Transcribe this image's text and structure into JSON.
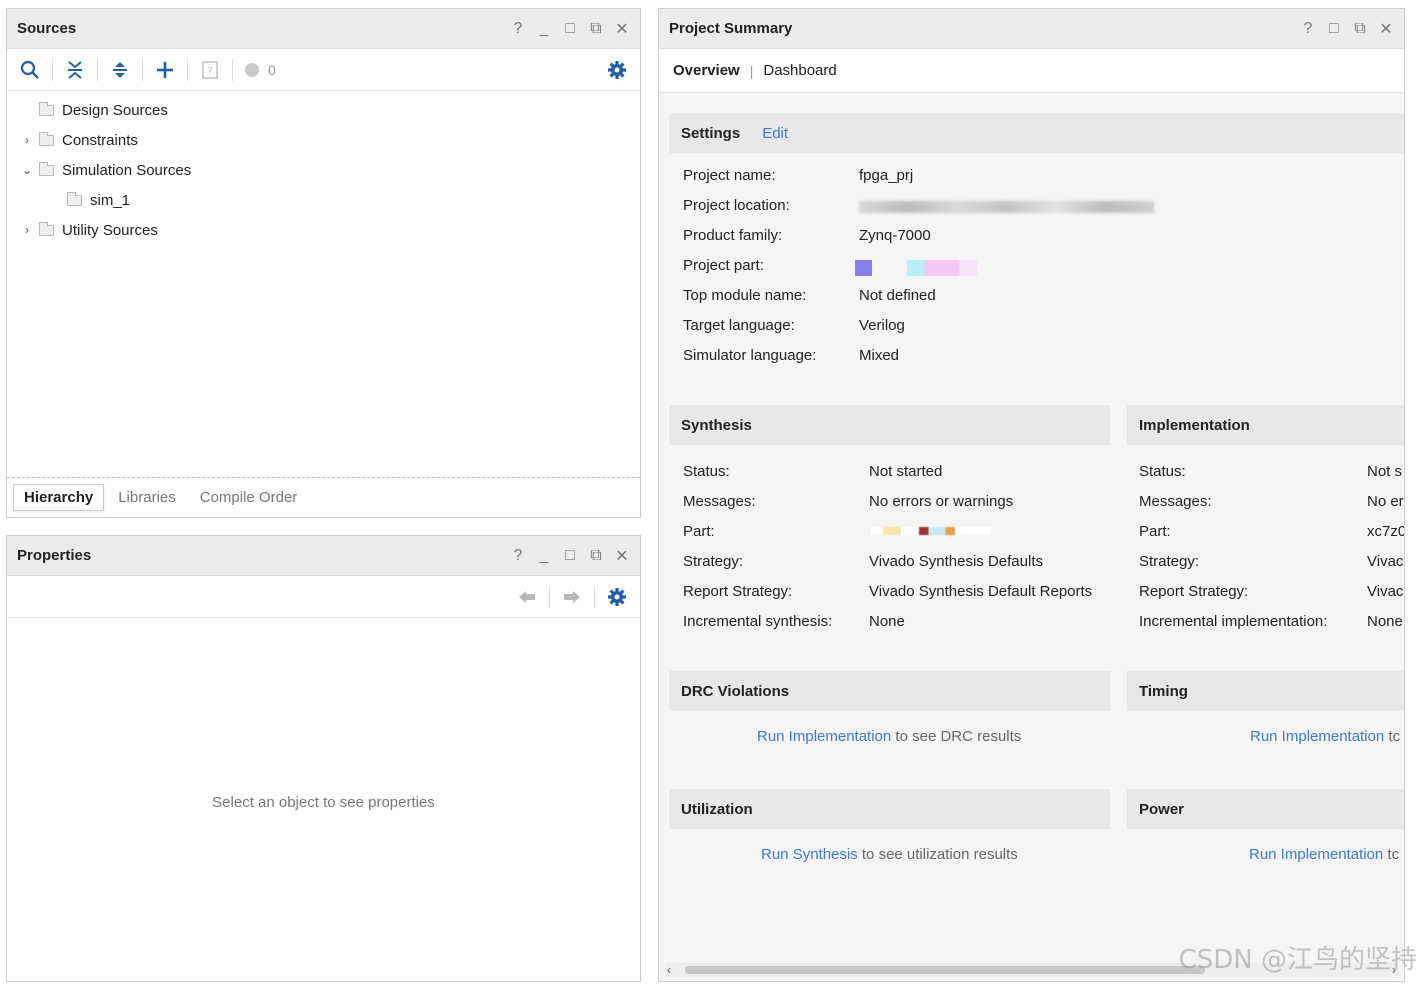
{
  "sources": {
    "title": "Sources",
    "controls": [
      "?",
      "_",
      "□",
      "⧉",
      "✕"
    ],
    "error_count": "0",
    "tree": [
      {
        "label": "Design Sources",
        "arrow": ""
      },
      {
        "label": "Constraints",
        "arrow": "›"
      },
      {
        "label": "Simulation Sources",
        "arrow": "⌄"
      },
      {
        "label": "sim_1",
        "arrow": ""
      },
      {
        "label": "Utility Sources",
        "arrow": "›"
      }
    ],
    "tabs": [
      "Hierarchy",
      "Libraries",
      "Compile Order"
    ]
  },
  "properties": {
    "title": "Properties",
    "controls": [
      "?",
      "_",
      "□",
      "⧉",
      "✕"
    ],
    "empty_message": "Select an object to see properties"
  },
  "summary": {
    "title": "Project Summary",
    "controls": [
      "?",
      "□",
      "⧉",
      "✕"
    ],
    "tabs": [
      "Overview",
      "Dashboard"
    ],
    "settings": {
      "heading": "Settings",
      "edit": "Edit",
      "rows": [
        {
          "label": "Project name:",
          "value": "fpga_prj"
        },
        {
          "label": "Project location:",
          "value": ""
        },
        {
          "label": "Product family:",
          "value": "Zynq-7000"
        },
        {
          "label": "Project part:",
          "value": ""
        },
        {
          "label": "Top module name:",
          "value": "Not defined"
        },
        {
          "label": "Target language:",
          "value": "Verilog"
        },
        {
          "label": "Simulator language:",
          "value": "Mixed"
        }
      ]
    },
    "synthesis": {
      "heading": "Synthesis",
      "rows": [
        {
          "label": "Status:",
          "value": "Not started"
        },
        {
          "label": "Messages:",
          "value": "No errors or warnings"
        },
        {
          "label": "Part:",
          "value": ""
        },
        {
          "label": "Strategy:",
          "value": "Vivado Synthesis Defaults"
        },
        {
          "label": "Report Strategy:",
          "value": "Vivado Synthesis Default Reports"
        },
        {
          "label": "Incremental synthesis:",
          "value": "None"
        }
      ]
    },
    "implementation": {
      "heading": "Implementation",
      "rows": [
        {
          "label": "Status:",
          "value": "Not s"
        },
        {
          "label": "Messages:",
          "value": "No er"
        },
        {
          "label": "Part:",
          "value": "xc7z0"
        },
        {
          "label": "Strategy:",
          "value": "Vivac"
        },
        {
          "label": "Report Strategy:",
          "value": "Vivac"
        },
        {
          "label": "Incremental implementation:",
          "value": "None"
        }
      ]
    },
    "drc": {
      "heading": "DRC Violations",
      "link": "Run Implementation",
      "text": "to see DRC results"
    },
    "timing": {
      "heading": "Timing",
      "link": "Run Implementation",
      "text": "tc"
    },
    "utilization": {
      "heading": "Utilization",
      "link": "Run Synthesis",
      "text": "to see utilization results"
    },
    "power": {
      "heading": "Power",
      "link": "Run Implementation",
      "text": "tc"
    }
  },
  "watermark": "CSDN @江鸟的坚持",
  "colors": {
    "link": "#3b7bd4",
    "accent": "#1f5fa8",
    "header_bg": "#ececec"
  }
}
